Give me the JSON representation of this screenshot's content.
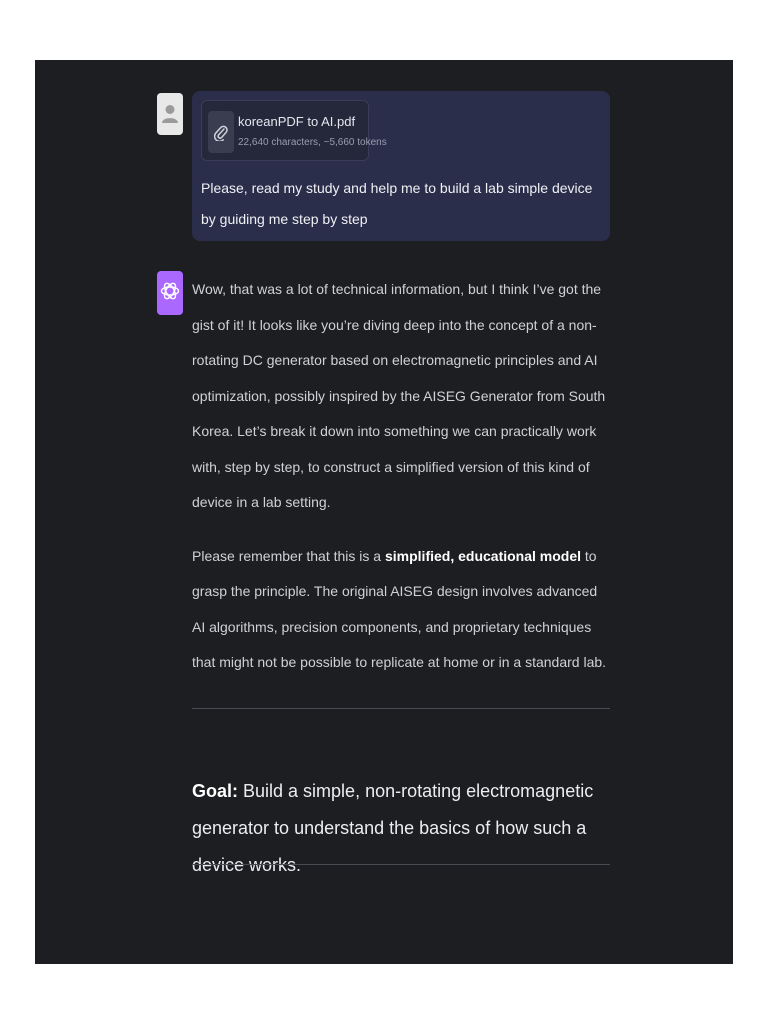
{
  "attachment": {
    "icon": "paperclip-icon",
    "name": "koreanPDF to AI.pdf",
    "meta": "22,640 characters, ~5,660 tokens"
  },
  "user_message": "Please, read my study and help me to build a lab simple device by guiding me step by step",
  "assistant": {
    "avatar_icon": "openai-logo-icon",
    "avatar_color": "#ab68ff",
    "paragraph1": "Wow, that was a lot of technical information, but I think I’ve got the gist of it! It looks like you’re diving deep into the concept of a non-rotating DC generator based on electromagnetic principles and AI optimization, possibly inspired by the AISEG Generator from South Korea. Let’s break it down into something we can practically work with, step by step, to construct a simplified version of this kind of device in a lab setting.",
    "paragraph2_before": "Please remember that this is a ",
    "paragraph2_bold": "simplified, educational model",
    "paragraph2_after": " to grasp the principle. The original AISEG design involves advanced AI algorithms, precision components, and proprietary techniques that might not be possible to replicate at home or in a standard lab.",
    "goal_label": "Goal:",
    "goal_text": " Build a simple, non-rotating electromagnetic generator to understand the basics of how such a device works."
  },
  "colors": {
    "background": "#1d1e21",
    "user_bubble": "#2b2e4b",
    "text": "#d0d1d6"
  }
}
